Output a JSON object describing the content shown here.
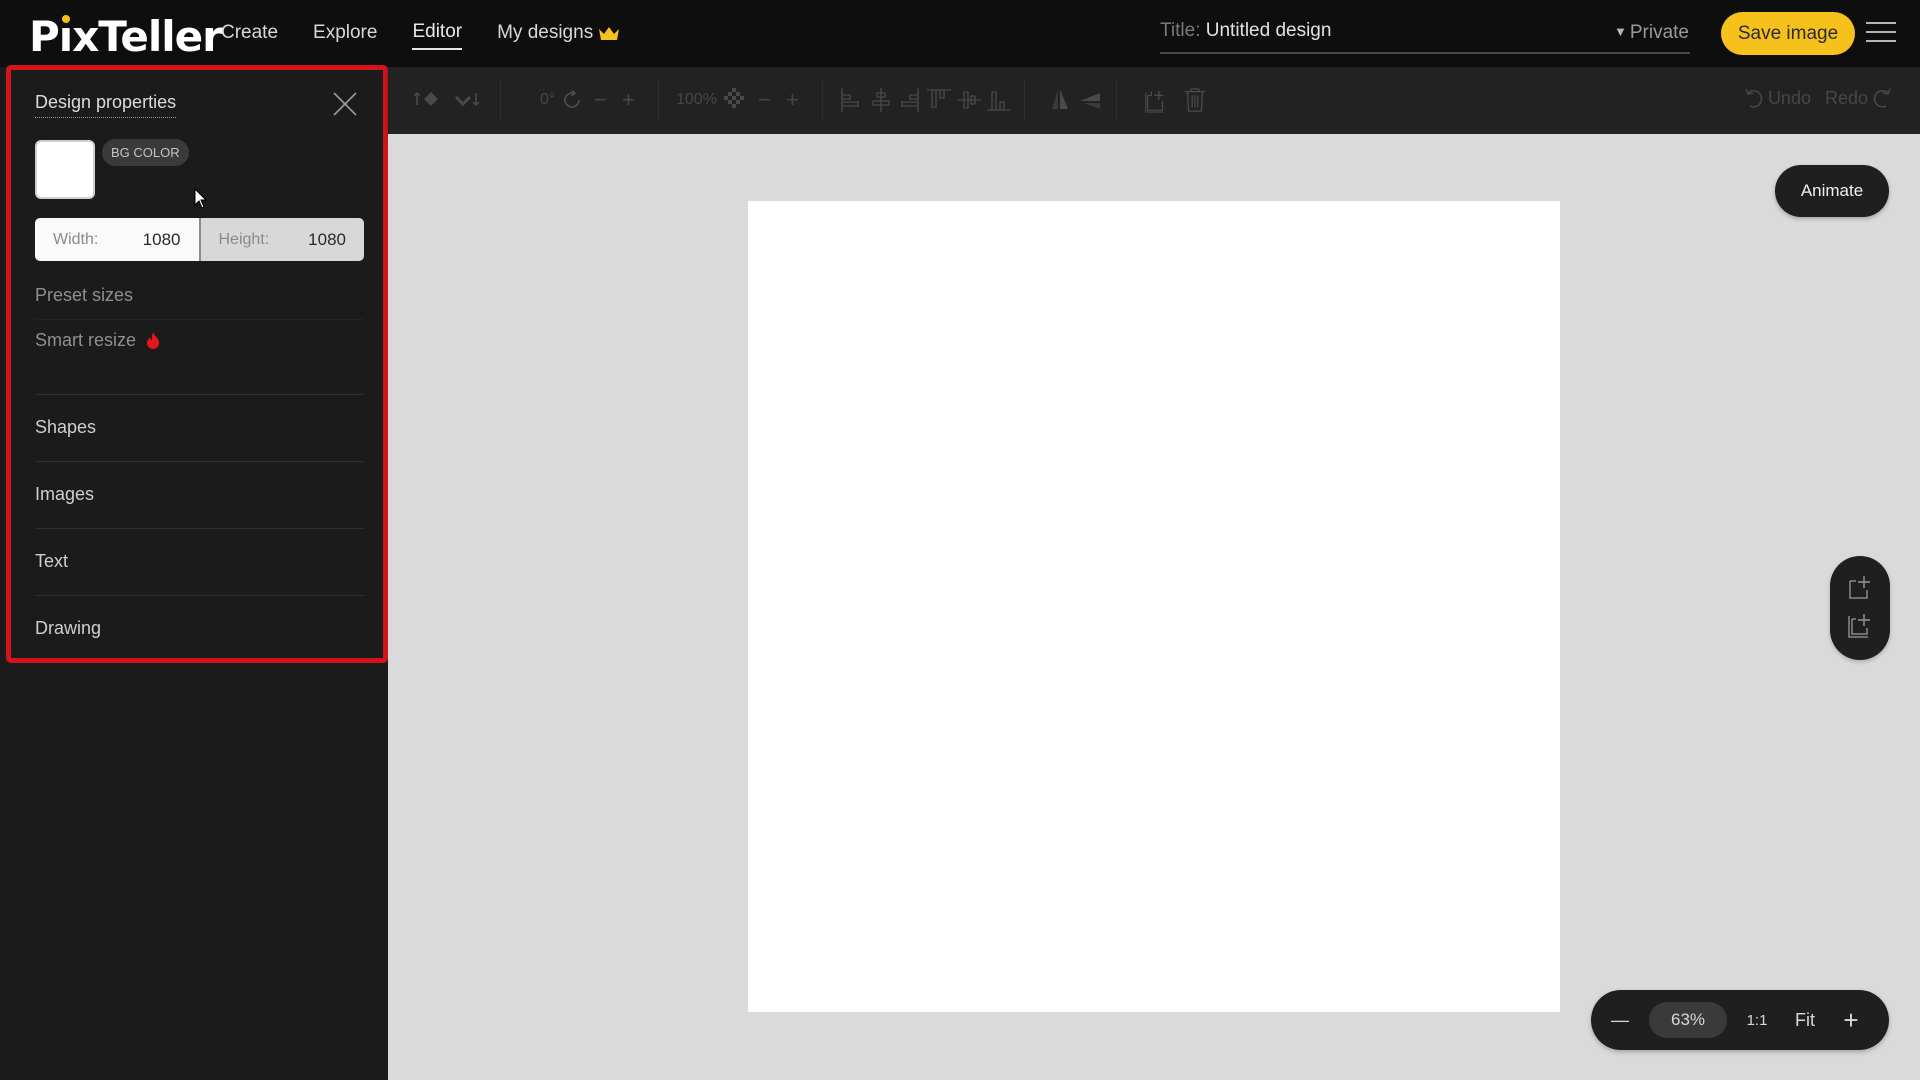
{
  "app": {
    "logo": "PixTeller"
  },
  "nav": {
    "items": [
      {
        "label": "Create"
      },
      {
        "label": "Explore"
      },
      {
        "label": "Editor",
        "active": true
      },
      {
        "label": "My designs",
        "icon": "crown-icon"
      }
    ]
  },
  "header": {
    "title_label": "Title:",
    "title_value": "Untitled design",
    "privacy": "Private",
    "save_label": "Save image",
    "accent_color": "#f6c11a"
  },
  "panel": {
    "title": "Design properties",
    "bg_color_label": "BG COLOR",
    "bg_color": "#ffffff",
    "width_label": "Width:",
    "width_value": "1080",
    "height_label": "Height:",
    "height_value": "1080",
    "preset_sizes": "Preset sizes",
    "smart_resize": "Smart resize",
    "sections": [
      "Shapes",
      "Images",
      "Text",
      "Drawing"
    ],
    "highlight_color": "#d2141b"
  },
  "toolbar": {
    "rotation": "0°",
    "opacity": "100%",
    "undo": "Undo",
    "redo": "Redo"
  },
  "workspace": {
    "animate_label": "Animate",
    "zoom": {
      "minus": "—",
      "percent": "63%",
      "one_to_one": "1:1",
      "fit": "Fit",
      "plus": "+"
    }
  }
}
